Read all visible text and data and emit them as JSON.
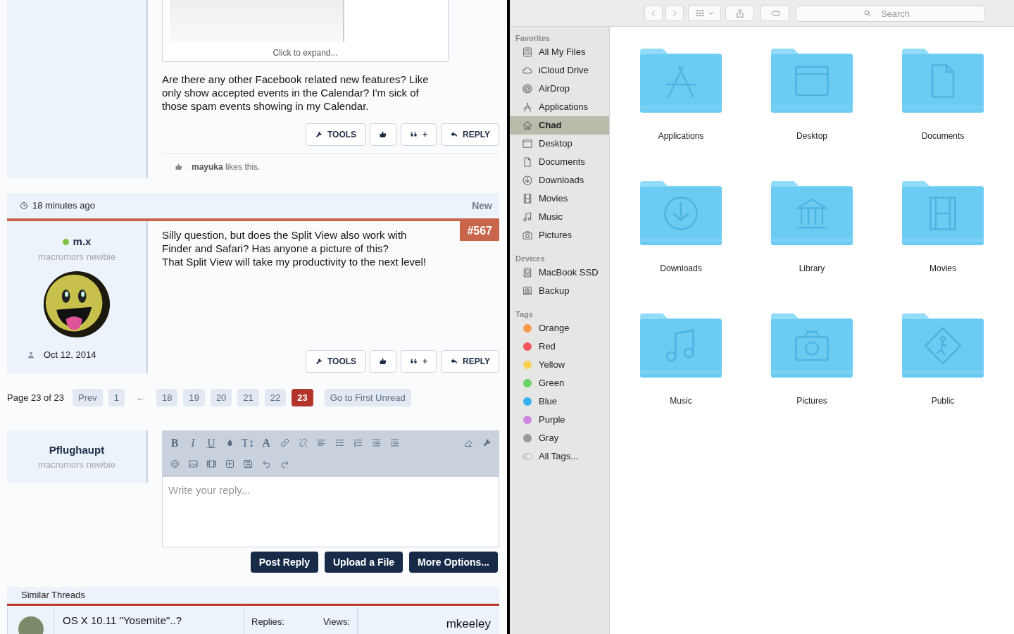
{
  "forum": {
    "previous_post": {
      "quote": {
        "expand_label": "Click to expand..."
      },
      "message": "Are there any other Facebook related new features? Like only show accepted events in the Calendar? I'm sick of those spam events showing in my Calendar.",
      "actions": [
        {
          "kind": "tools",
          "label": "TOOLS"
        },
        {
          "kind": "like"
        },
        {
          "kind": "quote",
          "label": "+"
        },
        {
          "kind": "reply",
          "label": "REPLY"
        }
      ],
      "likes": "**mayuka** likes this."
    },
    "post": {
      "time": "18 minutes ago",
      "status": "New",
      "number": "#567",
      "author": {
        "name": "m.x",
        "online": true,
        "title": "macrumors newbie",
        "joined": "Oct 12, 2014"
      },
      "message": "Silly question, but does the Split View also work with Finder and Safari? Has anyone a picture of this?\nThat Split View will take my productivity to the next level!",
      "actions": [
        {
          "kind": "tools",
          "label": "TOOLS"
        },
        {
          "kind": "like"
        },
        {
          "kind": "quote",
          "label": "+"
        },
        {
          "kind": "reply",
          "label": "REPLY"
        }
      ]
    },
    "pagination": {
      "summary": "Page 23 of 23",
      "items": [
        {
          "kind": "link",
          "label": "Prev",
          "selected": false
        },
        {
          "kind": "link",
          "label": "1",
          "selected": false
        },
        {
          "kind": "skip",
          "label": "←",
          "selected": false
        },
        {
          "kind": "link",
          "label": "18",
          "selected": false
        },
        {
          "kind": "link",
          "label": "19",
          "selected": false
        },
        {
          "kind": "link",
          "label": "20",
          "selected": false
        },
        {
          "kind": "link",
          "label": "21",
          "selected": false
        },
        {
          "kind": "link",
          "label": "22",
          "selected": false
        },
        {
          "kind": "link",
          "label": "23",
          "selected": true
        }
      ],
      "first_unread": "Go to First Unread"
    },
    "reply_form": {
      "author": {
        "name": "Pflughaupt",
        "title": "macrumors newbie"
      },
      "toolbar": [
        [
          {
            "kind": "bold",
            "label": "B"
          },
          {
            "kind": "italic",
            "label": "I"
          },
          {
            "kind": "underline",
            "label": "U"
          },
          {
            "kind": "color"
          },
          {
            "kind": "size",
            "label": "T↕"
          },
          {
            "kind": "font",
            "label": "A"
          },
          {
            "kind": "link"
          },
          {
            "kind": "unlink"
          },
          {
            "kind": "align"
          },
          {
            "kind": "bullets"
          },
          {
            "kind": "numbers"
          },
          {
            "kind": "outdent"
          },
          {
            "kind": "indent"
          },
          {
            "kind": "eraser"
          },
          {
            "kind": "tools"
          }
        ],
        [
          {
            "kind": "smiley"
          },
          {
            "kind": "image"
          },
          {
            "kind": "media"
          },
          {
            "kind": "insert"
          },
          {
            "kind": "save"
          },
          {
            "kind": "undo"
          },
          {
            "kind": "redo"
          }
        ]
      ],
      "placeholder": "Write your reply...",
      "buttons": [
        "Post Reply",
        "Upload a File",
        "More Options..."
      ]
    },
    "similar_threads": {
      "title": "Similar Threads",
      "rows": [
        {
          "title": "OS X 10.11 \"Yosemite\"..?",
          "replies_label": "Replies:",
          "views_label": "Views:",
          "last_poster": "mkeeley"
        }
      ]
    }
  },
  "finder": {
    "toolbar": {
      "search_placeholder": "Search"
    },
    "sidebar": {
      "sections": [
        {
          "title": "Favorites",
          "items": [
            {
              "label": "All My Files",
              "kind": "files",
              "selected": false
            },
            {
              "label": "iCloud Drive",
              "kind": "cloud",
              "selected": false
            },
            {
              "label": "AirDrop",
              "kind": "airdrop",
              "selected": false
            },
            {
              "label": "Applications",
              "kind": "apps",
              "selected": false
            },
            {
              "label": "Chad",
              "kind": "home",
              "selected": true
            },
            {
              "label": "Desktop",
              "kind": "desktop",
              "selected": false
            },
            {
              "label": "Documents",
              "kind": "documents",
              "selected": false
            },
            {
              "label": "Downloads",
              "kind": "downloads",
              "selected": false
            },
            {
              "label": "Movies",
              "kind": "movies",
              "selected": false
            },
            {
              "label": "Music",
              "kind": "music",
              "selected": false
            },
            {
              "label": "Pictures",
              "kind": "pictures",
              "selected": false
            }
          ]
        },
        {
          "title": "Devices",
          "items": [
            {
              "label": "MacBook SSD",
              "kind": "disk",
              "selected": false
            },
            {
              "label": "Backup",
              "kind": "backup",
              "selected": false
            }
          ]
        },
        {
          "title": "Tags",
          "items": [
            {
              "label": "Orange",
              "kind": "tag",
              "color": "#f9994a",
              "selected": false
            },
            {
              "label": "Red",
              "kind": "tag",
              "color": "#f4545a",
              "selected": false
            },
            {
              "label": "Yellow",
              "kind": "tag",
              "color": "#fbd155",
              "selected": false
            },
            {
              "label": "Green",
              "kind": "tag",
              "color": "#6bd164",
              "selected": false
            },
            {
              "label": "Blue",
              "kind": "tag",
              "color": "#3bb0f0",
              "selected": false
            },
            {
              "label": "Purple",
              "kind": "tag",
              "color": "#cf86e0",
              "selected": false
            },
            {
              "label": "Gray",
              "kind": "tag",
              "color": "#9a9a9e",
              "selected": false
            },
            {
              "label": "All Tags...",
              "kind": "all_tags",
              "selected": false
            }
          ]
        }
      ]
    },
    "folders": [
      {
        "name": "Applications",
        "kind": "apps"
      },
      {
        "name": "Desktop",
        "kind": "desktop"
      },
      {
        "name": "Documents",
        "kind": "documents"
      },
      {
        "name": "Downloads",
        "kind": "downloads"
      },
      {
        "name": "Library",
        "kind": "library"
      },
      {
        "name": "Movies",
        "kind": "movies"
      },
      {
        "name": "Music",
        "kind": "music"
      },
      {
        "name": "Pictures",
        "kind": "pictures"
      },
      {
        "name": "Public",
        "kind": "public"
      }
    ]
  }
}
